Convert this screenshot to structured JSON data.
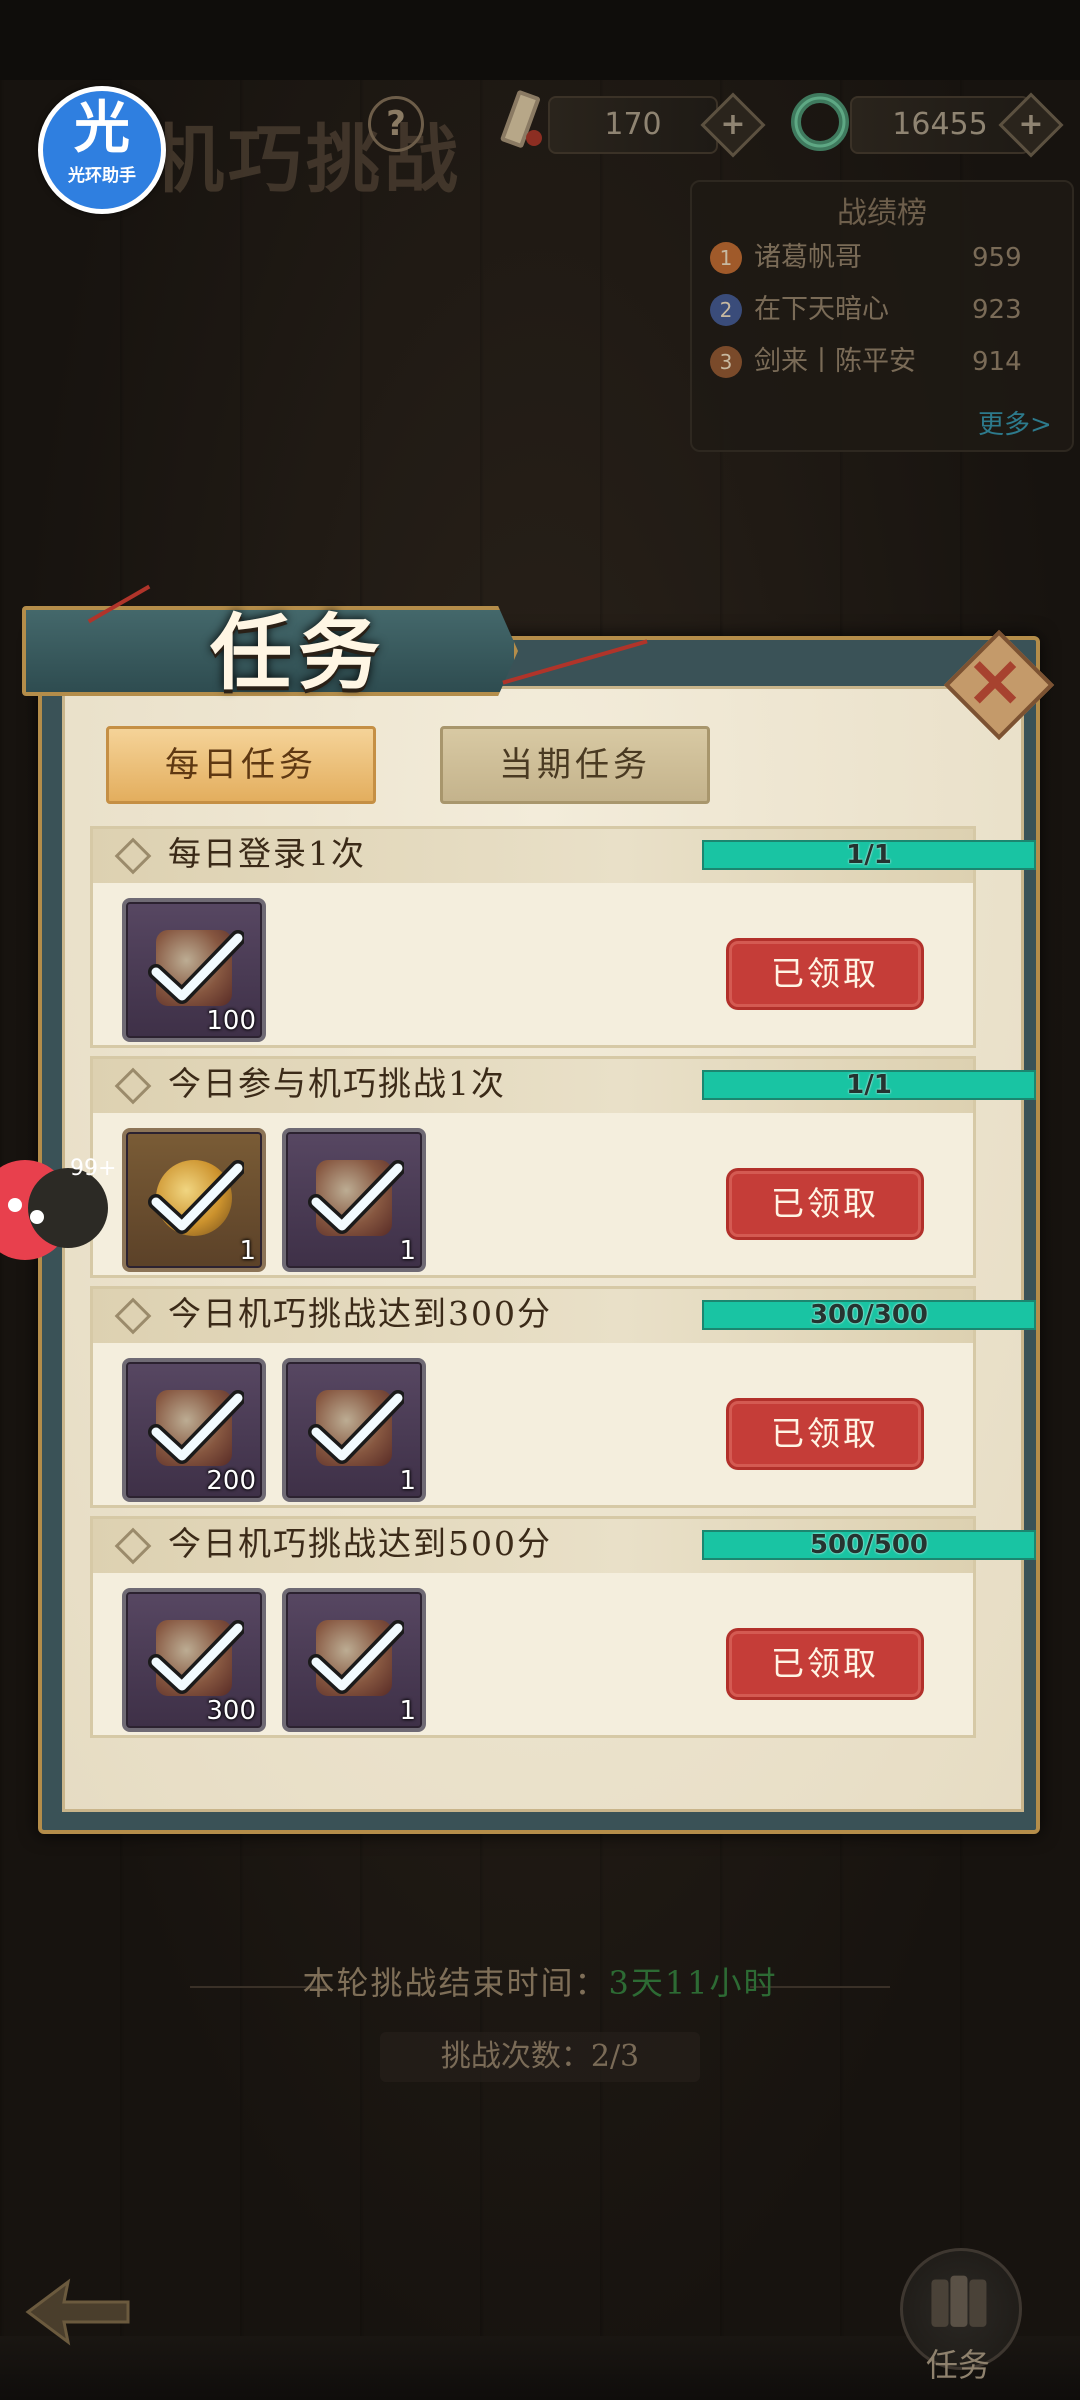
{
  "hud": {
    "logo_char": "光",
    "logo_sub": "光环助手",
    "game_title": "机巧挑战",
    "help_label": "?",
    "currency1_value": "170",
    "currency2_value": "16455",
    "plus_label": "+"
  },
  "leaderboard": {
    "title": "战绩榜",
    "rows": [
      {
        "rank": "1",
        "name": "诸葛帆哥",
        "score": "959",
        "color": "#a05a2a"
      },
      {
        "rank": "2",
        "name": "在下天暗心",
        "score": "923",
        "color": "#3a4c7a"
      },
      {
        "rank": "3",
        "name": "剑来丨陈平安",
        "score": "914",
        "color": "#7a4a2a"
      }
    ],
    "more": "更多>"
  },
  "floating_badge": "99+",
  "dialog": {
    "title": "任务",
    "close_label": "×",
    "tabs": [
      "每日任务",
      "当期任务"
    ],
    "tasks": [
      {
        "title": "每日登录1次",
        "progress_text": "1/1",
        "progress": 1.0,
        "claim_label": "已领取",
        "items": [
          {
            "kind": "scroll",
            "count": "100"
          }
        ]
      },
      {
        "title": "今日参与机巧挑战1次",
        "progress_text": "1/1",
        "progress": 1.0,
        "claim_label": "已领取",
        "items": [
          {
            "kind": "coin",
            "count": "1"
          },
          {
            "kind": "scroll",
            "count": "1"
          }
        ]
      },
      {
        "title": "今日机巧挑战达到300分",
        "progress_text": "300/300",
        "progress": 1.0,
        "claim_label": "已领取",
        "items": [
          {
            "kind": "scroll",
            "count": "200"
          },
          {
            "kind": "scroll",
            "count": "1"
          }
        ]
      },
      {
        "title": "今日机巧挑战达到500分",
        "progress_text": "500/500",
        "progress": 1.0,
        "claim_label": "已领取",
        "items": [
          {
            "kind": "scroll",
            "count": "300"
          },
          {
            "kind": "scroll",
            "count": "1"
          }
        ]
      }
    ]
  },
  "footer": {
    "end_time_label": "本轮挑战结束时间：",
    "end_time_value": "3天11小时",
    "attempts": "挑战次数：2/3",
    "task_corner_label": "任务"
  },
  "colors": {
    "accent_teal": "#1bbf9f",
    "claim_red": "#c53d38",
    "tab_gold": "#e3ae5e"
  }
}
